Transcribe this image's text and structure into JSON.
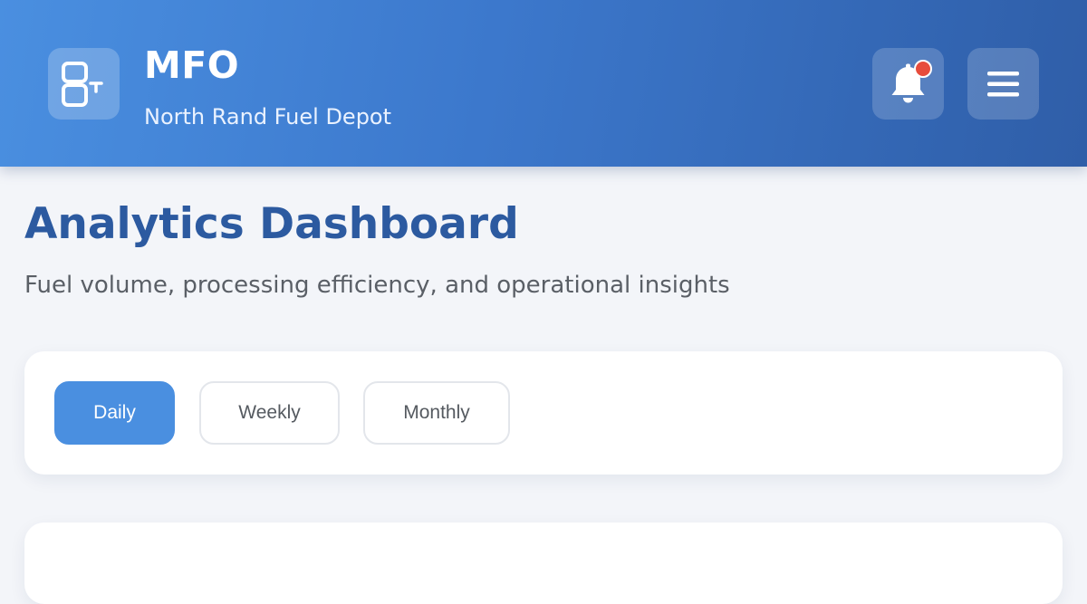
{
  "header": {
    "logo_icon": "fuel-logo-icon",
    "title": "MFO",
    "subtitle": "North Rand Fuel Depot",
    "notification_icon": "bell-icon",
    "notification_badge_color": "#e74c3c",
    "menu_icon": "hamburger-menu-icon",
    "gradient_start": "#4a8fe0",
    "gradient_end": "#2f5ea8"
  },
  "page": {
    "title": "Analytics Dashboard",
    "subtitle": "Fuel volume, processing efficiency, and operational insights"
  },
  "filters": {
    "options": [
      {
        "label": "Daily",
        "active": true
      },
      {
        "label": "Weekly",
        "active": false
      },
      {
        "label": "Monthly",
        "active": false
      }
    ],
    "active_color": "#4a8fe0"
  }
}
